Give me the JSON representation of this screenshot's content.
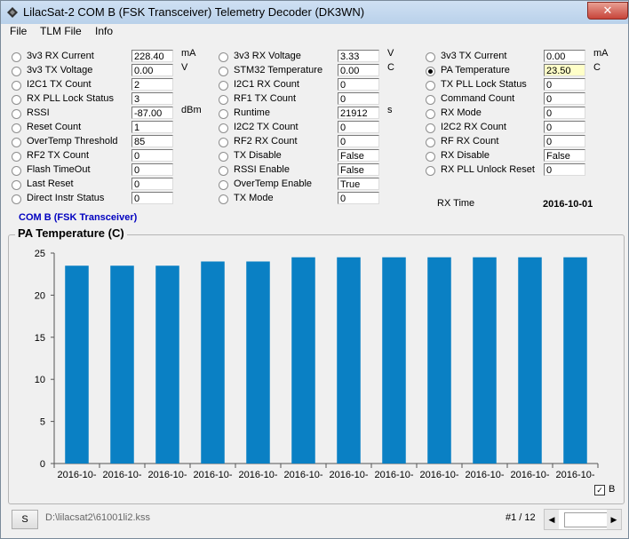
{
  "window": {
    "title": "LilacSat-2 COM B (FSK Transceiver) Telemetry Decoder (DK3WN)",
    "close_label": "✕"
  },
  "menu": [
    "File",
    "TLM File",
    "Info"
  ],
  "col1": [
    {
      "label": "3v3 RX Current",
      "value": "228.40",
      "unit": "mA"
    },
    {
      "label": "3v3 TX Voltage",
      "value": "0.00",
      "unit": "V"
    },
    {
      "label": "I2C1 TX Count",
      "value": "2",
      "unit": ""
    },
    {
      "label": "RX PLL Lock Status",
      "value": "3",
      "unit": ""
    },
    {
      "label": "RSSI",
      "value": "-87.00",
      "unit": "dBm"
    },
    {
      "label": "Reset Count",
      "value": "1",
      "unit": ""
    },
    {
      "label": "OverTemp Threshold",
      "value": "85",
      "unit": ""
    },
    {
      "label": "RF2 TX Count",
      "value": "0",
      "unit": ""
    },
    {
      "label": "Flash TimeOut",
      "value": "0",
      "unit": ""
    },
    {
      "label": "Last Reset",
      "value": "0",
      "unit": ""
    },
    {
      "label": "Direct Instr Status",
      "value": "0",
      "unit": ""
    }
  ],
  "col2": [
    {
      "label": "3v3 RX Voltage",
      "value": "3.33",
      "unit": "V"
    },
    {
      "label": "STM32 Temperature",
      "value": "0.00",
      "unit": "C"
    },
    {
      "label": "I2C1 RX Count",
      "value": "0",
      "unit": ""
    },
    {
      "label": "RF1 TX Count",
      "value": "0",
      "unit": ""
    },
    {
      "label": "Runtime",
      "value": "21912",
      "unit": "s"
    },
    {
      "label": "I2C2 TX Count",
      "value": "0",
      "unit": ""
    },
    {
      "label": "RF2 RX Count",
      "value": "0",
      "unit": ""
    },
    {
      "label": "TX Disable",
      "value": "False",
      "unit": ""
    },
    {
      "label": "RSSI Enable",
      "value": "False",
      "unit": ""
    },
    {
      "label": "OverTemp Enable",
      "value": "True",
      "unit": ""
    },
    {
      "label": "TX Mode",
      "value": "0",
      "unit": ""
    }
  ],
  "col3": [
    {
      "label": "3v3 TX Current",
      "value": "0.00",
      "unit": "mA"
    },
    {
      "label": "PA Temperature",
      "value": "23.50",
      "unit": "C"
    },
    {
      "label": "TX PLL Lock Status",
      "value": "0",
      "unit": ""
    },
    {
      "label": "Command Count",
      "value": "0",
      "unit": ""
    },
    {
      "label": "RX Mode",
      "value": "0",
      "unit": ""
    },
    {
      "label": "I2C2 RX Count",
      "value": "0",
      "unit": ""
    },
    {
      "label": "RF RX Count",
      "value": "0",
      "unit": ""
    },
    {
      "label": "RX Disable",
      "value": "False",
      "unit": ""
    },
    {
      "label": "RX PLL Unlock Reset",
      "value": "0",
      "unit": ""
    }
  ],
  "selected_parameter": "PA Temperature",
  "rx_time": {
    "label": "RX Time",
    "value": "2016-10-01"
  },
  "group_label": "COM B (FSK Transceiver)",
  "chart_title": "PA Temperature (C)",
  "chart_data": {
    "type": "bar",
    "title": "PA Temperature (C)",
    "categories": [
      "2016-10-",
      "2016-10-",
      "2016-10-",
      "2016-10-",
      "2016-10-",
      "2016-10-",
      "2016-10-",
      "2016-10-",
      "2016-10-",
      "2016-10-",
      "2016-10-",
      "2016-10-"
    ],
    "series": [
      {
        "name": "B",
        "values": [
          23.5,
          23.5,
          23.5,
          24.0,
          24.0,
          24.5,
          24.5,
          24.5,
          24.5,
          24.5,
          24.5,
          24.5
        ],
        "color": "#0a80c4"
      }
    ],
    "ylim": [
      0,
      25
    ],
    "yticks": [
      0,
      5,
      10,
      15,
      20,
      25
    ],
    "grid": false,
    "legend": "bottom-right"
  },
  "legend": {
    "label": "B",
    "check": "✓"
  },
  "footer": {
    "button": "S",
    "file_path": "D:\\lilacsat2\\61001li2.kss",
    "page": "#1 / 12",
    "left_arrow": "◀",
    "right_arrow": "▶"
  }
}
